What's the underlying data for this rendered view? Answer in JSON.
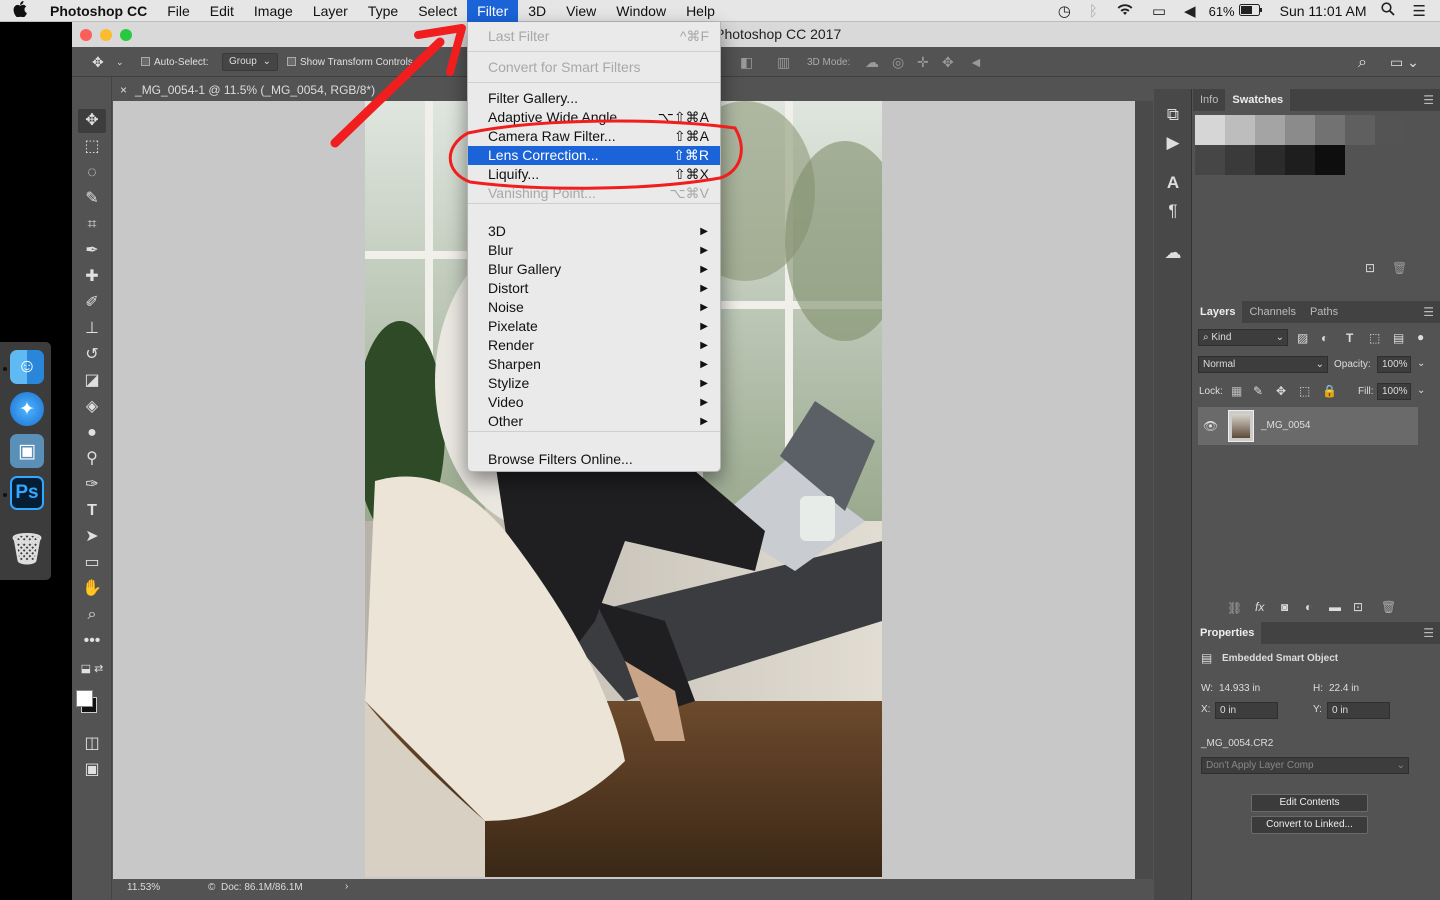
{
  "menubar": {
    "apple_icon": "apple-icon",
    "items": [
      "Photoshop CC",
      "File",
      "Edit",
      "Image",
      "Layer",
      "Type",
      "Select",
      "Filter",
      "3D",
      "View",
      "Window",
      "Help"
    ],
    "active_item": "Filter",
    "battery": "61%",
    "clock": "Sun 11:01 AM"
  },
  "window": {
    "title": "Adobe Photoshop CC 2017"
  },
  "options_bar": {
    "auto_select_label": "Auto-Select:",
    "auto_select_value": "Group",
    "show_transform_label": "Show Transform Controls",
    "mode_3d_label": "3D Mode:"
  },
  "document": {
    "tab_title": "_MG_0054-1 @ 11.5% (_MG_0054, RGB/8*)",
    "zoom": "11.53%",
    "doc_size": "Doc: 86.1M/86.1M"
  },
  "filter_menu": {
    "items": [
      {
        "label": "Last Filter",
        "shortcut": "^⌘F",
        "disabled": true
      },
      {
        "label": "Convert for Smart Filters",
        "shortcut": "",
        "disabled": true
      },
      {
        "label": "Filter Gallery...",
        "shortcut": ""
      },
      {
        "label": "Adaptive Wide Angle...",
        "shortcut": "⌥⇧⌘A"
      },
      {
        "label": "Camera Raw Filter...",
        "shortcut": "⇧⌘A"
      },
      {
        "label": "Lens Correction...",
        "shortcut": "⇧⌘R",
        "highlighted": true
      },
      {
        "label": "Liquify...",
        "shortcut": "⇧⌘X"
      },
      {
        "label": "Vanishing Point...",
        "shortcut": "⌥⌘V",
        "disabled": true
      },
      {
        "label": "3D",
        "submenu": true
      },
      {
        "label": "Blur",
        "submenu": true
      },
      {
        "label": "Blur Gallery",
        "submenu": true
      },
      {
        "label": "Distort",
        "submenu": true
      },
      {
        "label": "Noise",
        "submenu": true
      },
      {
        "label": "Pixelate",
        "submenu": true
      },
      {
        "label": "Render",
        "submenu": true
      },
      {
        "label": "Sharpen",
        "submenu": true
      },
      {
        "label": "Stylize",
        "submenu": true
      },
      {
        "label": "Video",
        "submenu": true
      },
      {
        "label": "Other",
        "submenu": true
      },
      {
        "label": "Browse Filters Online..."
      }
    ]
  },
  "swatches_panel": {
    "tabs": [
      "Info",
      "Swatches"
    ],
    "active_tab": "Swatches",
    "colors": [
      "#d6d6d6",
      "#bdbdbd",
      "#a4a4a4",
      "#8b8b8b",
      "#727272",
      "#5f5f5f",
      "#545454",
      "#464646",
      "#3a3a3a",
      "#2b2b2b",
      "#1e1e1e",
      "#0e0e0e"
    ]
  },
  "layers_panel": {
    "tabs": [
      "Layers",
      "Channels",
      "Paths"
    ],
    "active_tab": "Layers",
    "filter_kind": "Kind",
    "blend_mode": "Normal",
    "opacity_label": "Opacity:",
    "opacity": "100%",
    "lock_label": "Lock:",
    "fill_label": "Fill:",
    "fill": "100%",
    "layers": [
      {
        "name": "_MG_0054",
        "visible": true
      }
    ]
  },
  "properties_panel": {
    "title": "Properties",
    "type": "Embedded Smart Object",
    "w_label": "W:",
    "w": "14.933 in",
    "h_label": "H:",
    "h": "22.4 in",
    "x_label": "X:",
    "x": "0 in",
    "y_label": "Y:",
    "y": "0 in",
    "source_file": "_MG_0054.CR2",
    "layer_comp": "Don't Apply Layer Comp",
    "edit_contents_button": "Edit Contents",
    "convert_linked_button": "Convert to Linked..."
  },
  "dock": {
    "apps": [
      "finder-icon",
      "safari-icon",
      "preview-icon",
      "photoshop-icon",
      "trash-icon"
    ],
    "ps_label": "Ps"
  }
}
